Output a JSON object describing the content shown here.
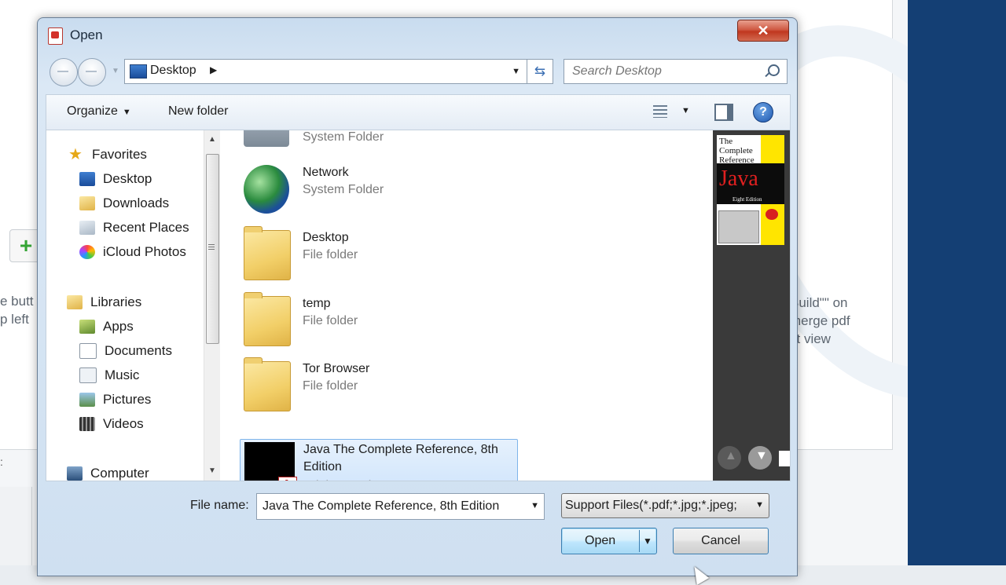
{
  "background": {
    "left_text": [
      "e butt",
      "p left"
    ],
    "right_text": [
      "Build\"\" on",
      "merge pdf",
      "st view"
    ],
    "dots": ":"
  },
  "dialog": {
    "title": "Open",
    "close_label": "✕",
    "address": {
      "location": "Desktop"
    },
    "search": {
      "placeholder": "Search Desktop"
    },
    "toolbar": {
      "organize": "Organize",
      "new_folder": "New folder",
      "help": "?"
    },
    "nav": {
      "favorites": "Favorites",
      "favorites_items": [
        "Desktop",
        "Downloads",
        "Recent Places",
        "iCloud Photos"
      ],
      "libraries": "Libraries",
      "library_items": [
        "Apps",
        "Documents",
        "Music",
        "Pictures",
        "Videos"
      ],
      "computer": "Computer"
    },
    "files": [
      {
        "name": "",
        "type": "System Folder"
      },
      {
        "name": "Network",
        "type": "System Folder"
      },
      {
        "name": "Desktop",
        "type": "File folder"
      },
      {
        "name": "temp",
        "type": "File folder"
      },
      {
        "name": "Tor Browser",
        "type": "File folder"
      },
      {
        "name": "Java The Complete Reference, 8th Edition",
        "type": "Adobe Acrobat Document"
      }
    ],
    "preview": {
      "title_line1": "The",
      "title_line2": "Complete",
      "title_line3": "Reference",
      "java": "Java",
      "edition": "Eight Edition"
    },
    "file_name_label": "File name:",
    "file_name_value": "Java The Complete Reference, 8th Edition",
    "file_type": "Support Files(*.pdf;*.jpg;*.jpeg;",
    "open_label": "Open",
    "cancel_label": "Cancel"
  }
}
